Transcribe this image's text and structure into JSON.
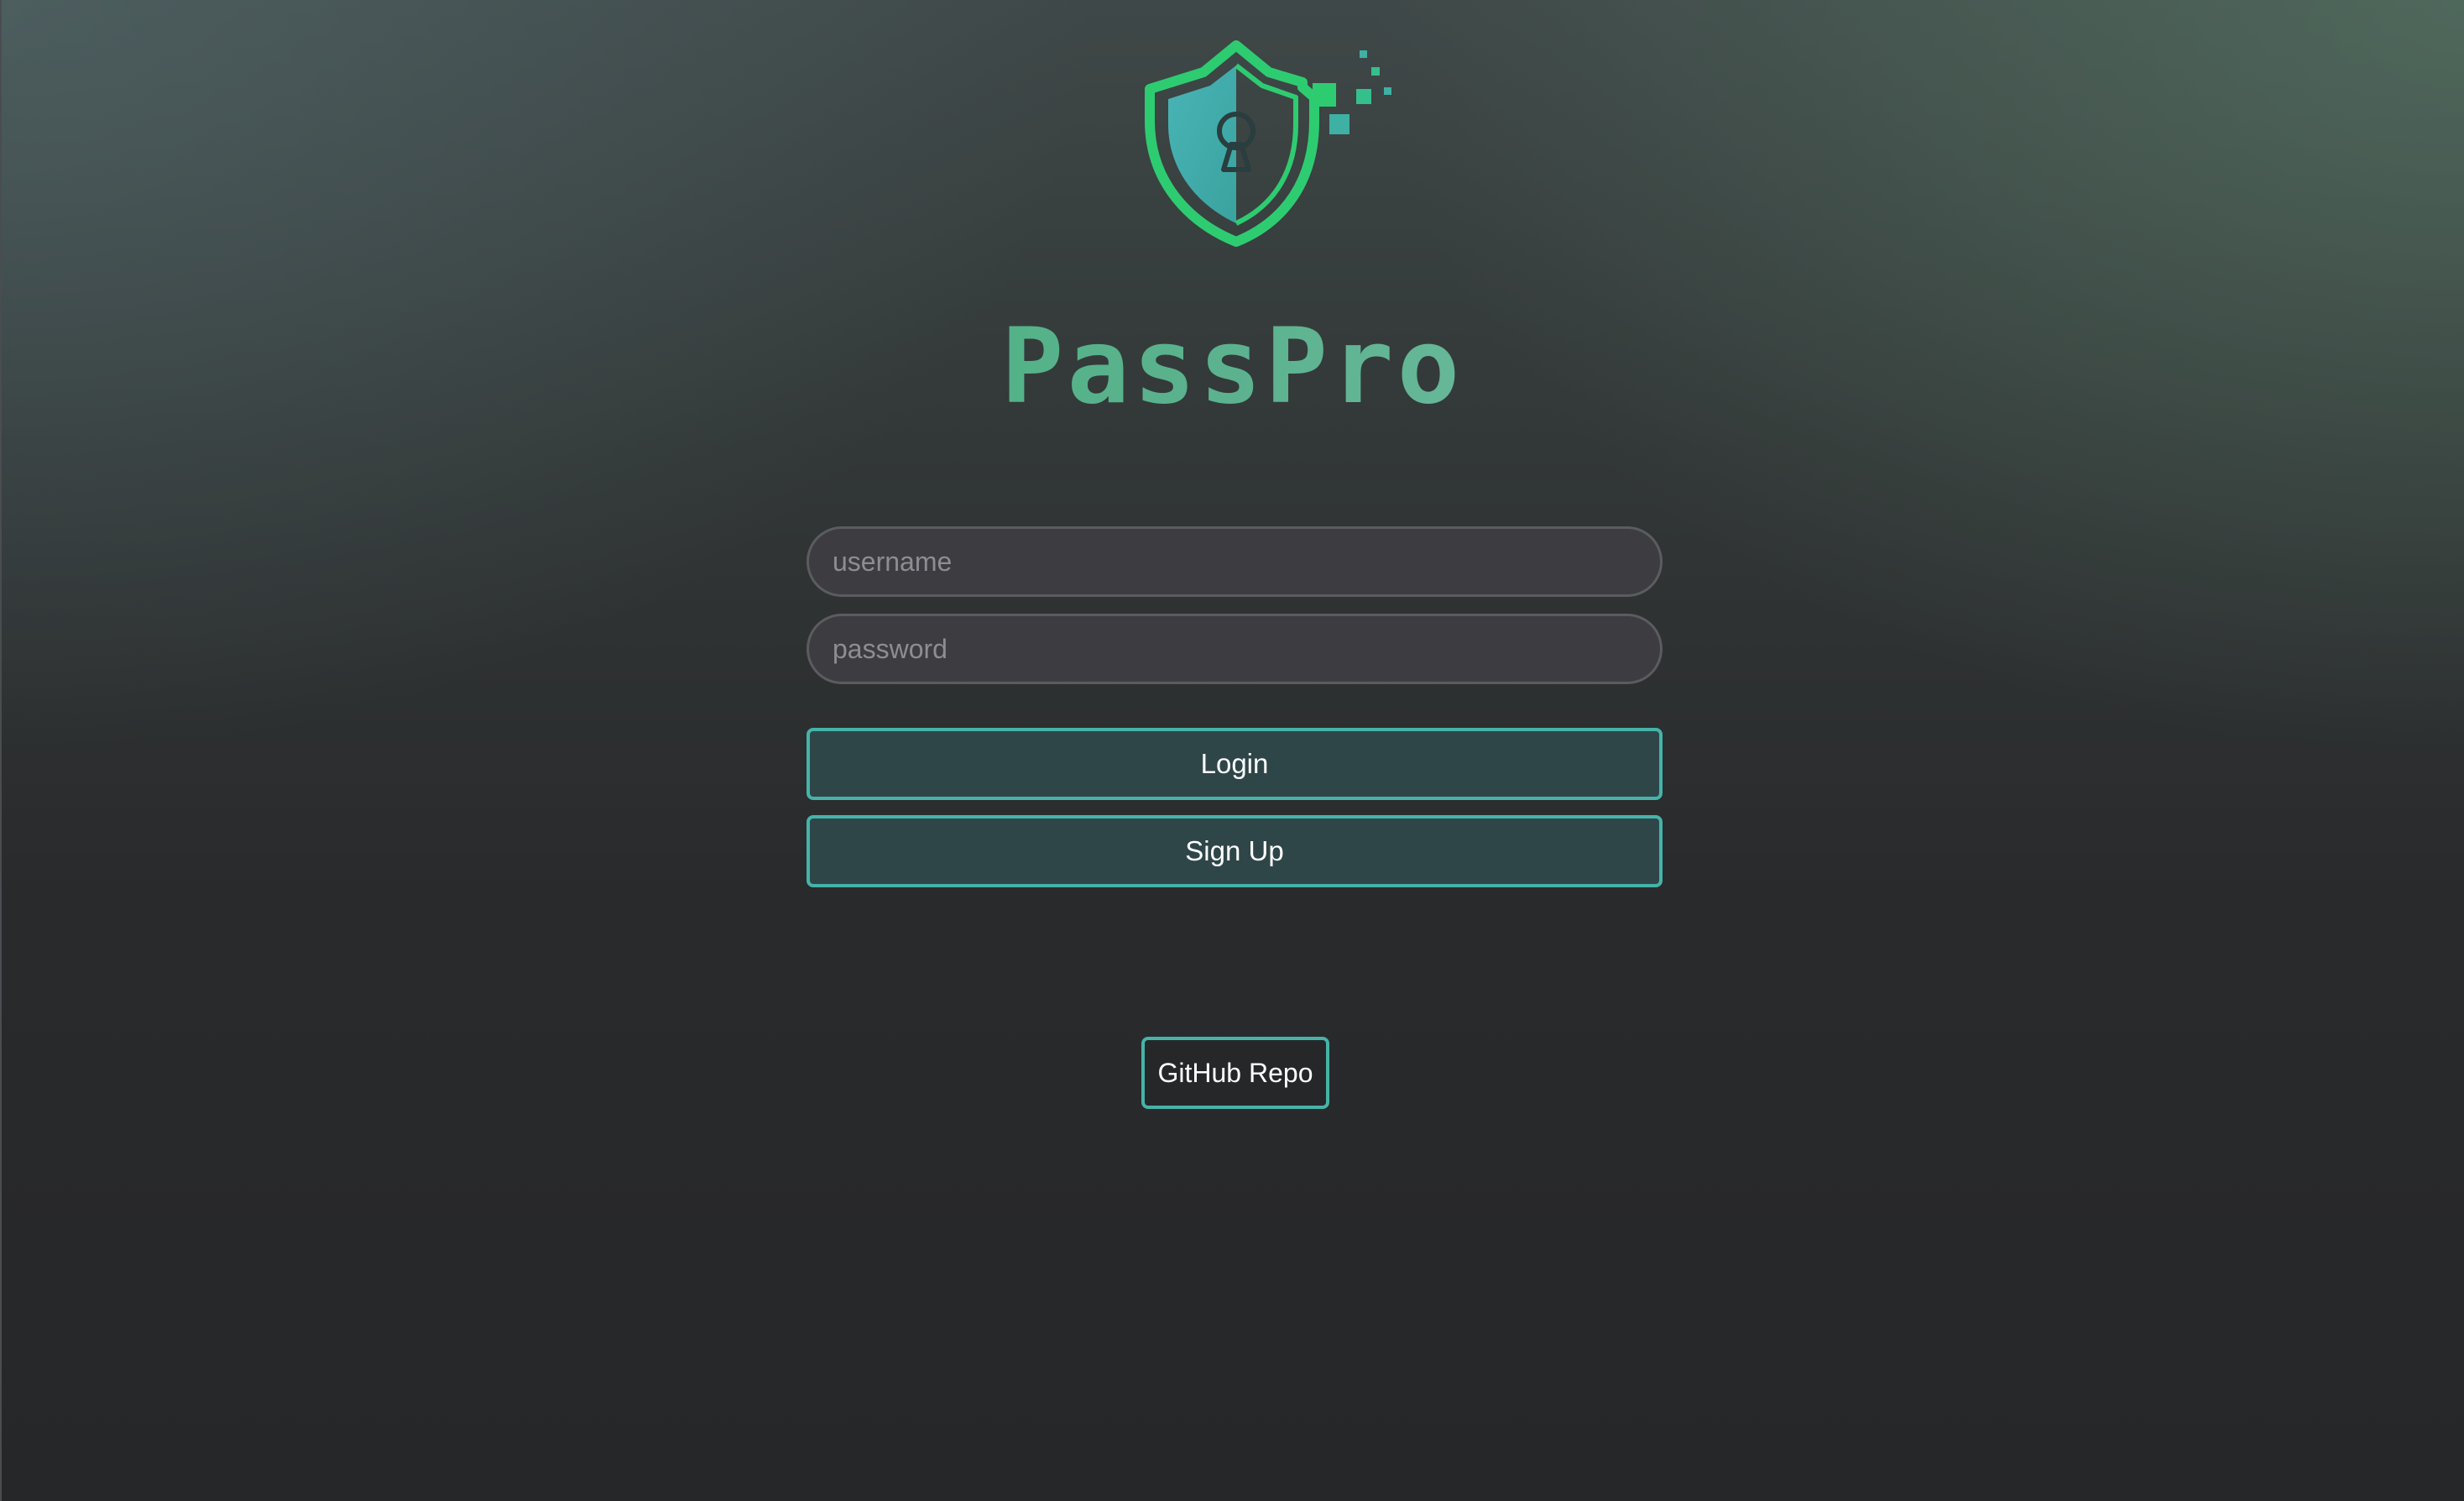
{
  "app": {
    "name": "PassPro",
    "logo_icon": "shield-keyhole-icon",
    "colors": {
      "brand_green": "#2ecc71",
      "brand_teal": "#46b3a9",
      "background": "#262729",
      "input_background": "#3d3c41",
      "button_background": "#2f4649"
    }
  },
  "login_form": {
    "username_placeholder": "username",
    "username_value": "",
    "password_placeholder": "password",
    "password_value": "",
    "login_label": "Login",
    "signup_label": "Sign Up"
  },
  "footer": {
    "github_label": "GitHub Repo"
  }
}
